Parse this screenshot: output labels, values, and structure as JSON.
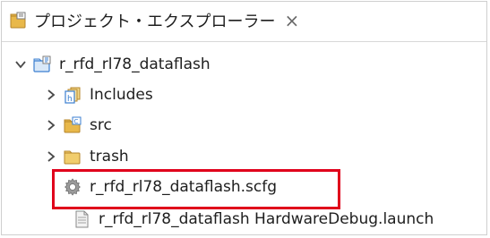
{
  "tab": {
    "title": "プロジェクト・エクスプローラー",
    "close": "×",
    "icon": "project-explorer-icon"
  },
  "tree": {
    "project": {
      "label": "r_rfd_rl78_dataflash",
      "expanded": true,
      "icon": "project-folder-icon"
    },
    "items": [
      {
        "label": "Includes",
        "icon": "includes-icon",
        "expandable": true
      },
      {
        "label": "src",
        "icon": "source-folder-icon",
        "expandable": true
      },
      {
        "label": "trash",
        "icon": "folder-icon",
        "expandable": true
      },
      {
        "label": "r_rfd_rl78_dataflash.scfg",
        "icon": "gear-icon",
        "expandable": false,
        "highlighted": true
      },
      {
        "label": "r_rfd_rl78_dataflash HardwareDebug.launch",
        "icon": "launch-file-icon",
        "expandable": false
      }
    ]
  },
  "colors": {
    "highlight": "#e0001b",
    "folder": "#e8b84a",
    "accent": "#3b7fd0"
  }
}
